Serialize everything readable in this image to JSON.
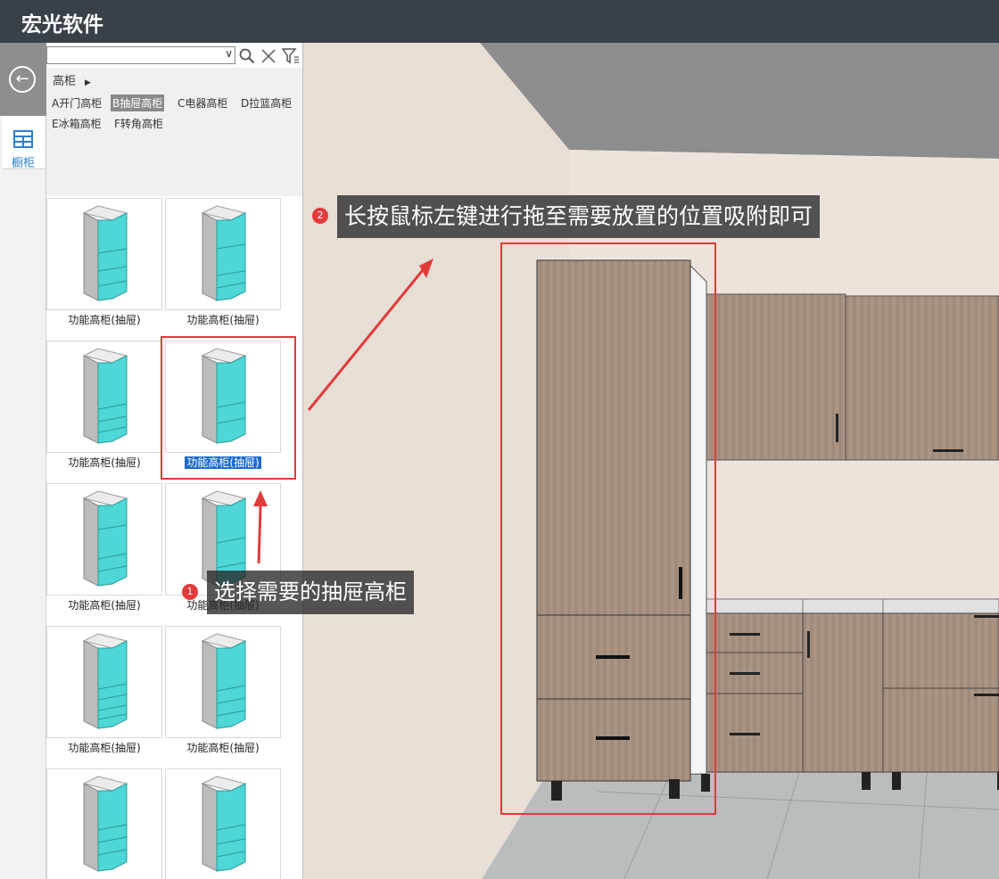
{
  "app": {
    "title": "宏光软件"
  },
  "rail": {
    "back_icon": "arrow-left-circle-icon",
    "cabinet_label": "橱柜",
    "cabinet_icon": "cabinet-grid-icon"
  },
  "panel": {
    "search": {
      "value": "",
      "dropdown_icon": "chevron-down-icon",
      "search_icon": "search-icon",
      "clear_icon": "close-icon",
      "filter_icon": "filter-icon"
    },
    "breadcrumb": "高柜",
    "categories": [
      {
        "label": "A开门高柜",
        "active": false
      },
      {
        "label": "B抽屉高柜",
        "active": true
      },
      {
        "label": "C电器高柜",
        "active": false
      },
      {
        "label": "D拉篮高柜",
        "active": false
      },
      {
        "label": "E冰箱高柜",
        "active": false
      },
      {
        "label": "F转角高柜",
        "active": false
      }
    ],
    "items": [
      {
        "label": "功能高柜(抽屉)"
      },
      {
        "label": "功能高柜(抽屉)"
      },
      {
        "label": "功能高柜(抽屉)"
      },
      {
        "label": "功能高柜(抽屉)",
        "selected": true
      },
      {
        "label": "功能高柜(抽屉)"
      },
      {
        "label": "功能高柜(抽屉)"
      },
      {
        "label": "功能高柜(抽屉)"
      },
      {
        "label": "功能高柜(抽屉)"
      },
      {
        "label": "",
        "partial": true
      },
      {
        "label": "",
        "partial": true
      }
    ]
  },
  "annotations": {
    "step1": {
      "number": "1",
      "text": "选择需要的抽屉高柜"
    },
    "step2": {
      "number": "2",
      "text": "长按鼠标左键进行拖至需要放置的位置吸附即可"
    }
  },
  "colors": {
    "titlebar": "#3a4048",
    "accent": "#1c6ad1",
    "annotation": "#e23a3a",
    "cabinet_front": "#4fd6d6",
    "wood": "#a69080",
    "wall": "#e9e1d8",
    "floor": "#b9bdbd"
  }
}
